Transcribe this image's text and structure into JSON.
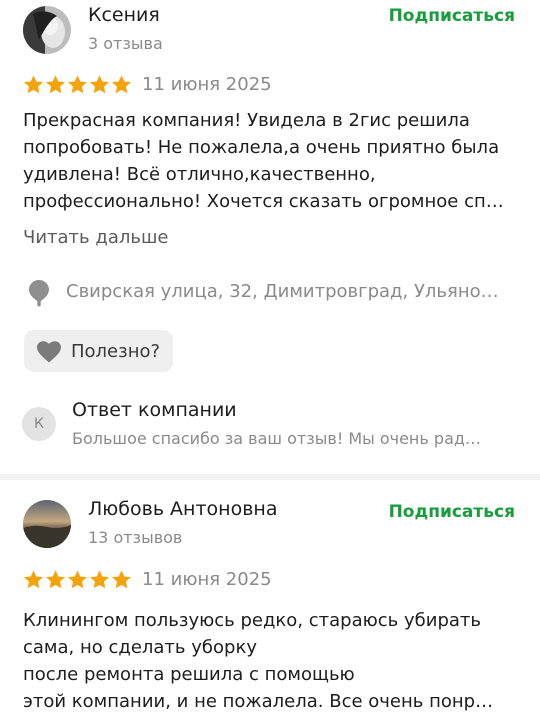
{
  "reviews": [
    {
      "author": "Ксения",
      "review_count": "3 отзыва",
      "subscribe_label": "Подписаться",
      "rating": 5,
      "date": "11 июня 2025",
      "text_lines": [
        "Прекрасная компания! Увидела в 2гис решила",
        "попробовать! Не пожалела,а очень приятно была",
        "удивлена! Всё отлично,качественно,",
        "профессионально! Хочется сказать огромное сп…"
      ],
      "read_more_label": "Читать дальше",
      "address": "Свирская улица, 32, Димитровград, Ульяно…",
      "helpful_label": "Полезно?",
      "reply": {
        "avatar_letter": "К",
        "title": "Ответ компании",
        "text": "Большое спасибо за ваш отзыв! Мы очень рад…"
      }
    },
    {
      "author": "Любовь Антоновна",
      "review_count": "13 отзывов",
      "subscribe_label": "Подписаться",
      "rating": 5,
      "date": "11 июня 2025",
      "text_lines": [
        "Клинингом пользуюсь редко, стараюсь убирать",
        "сама, но сделать уборку",
        "после ремонта решила с помощью",
        "этой компании, и не пожалела. Все очень понр…"
      ]
    }
  ],
  "colors": {
    "accent_green": "#1a9c3e",
    "star_orange": "#f5a30a",
    "muted_text": "#8a8a8a"
  }
}
